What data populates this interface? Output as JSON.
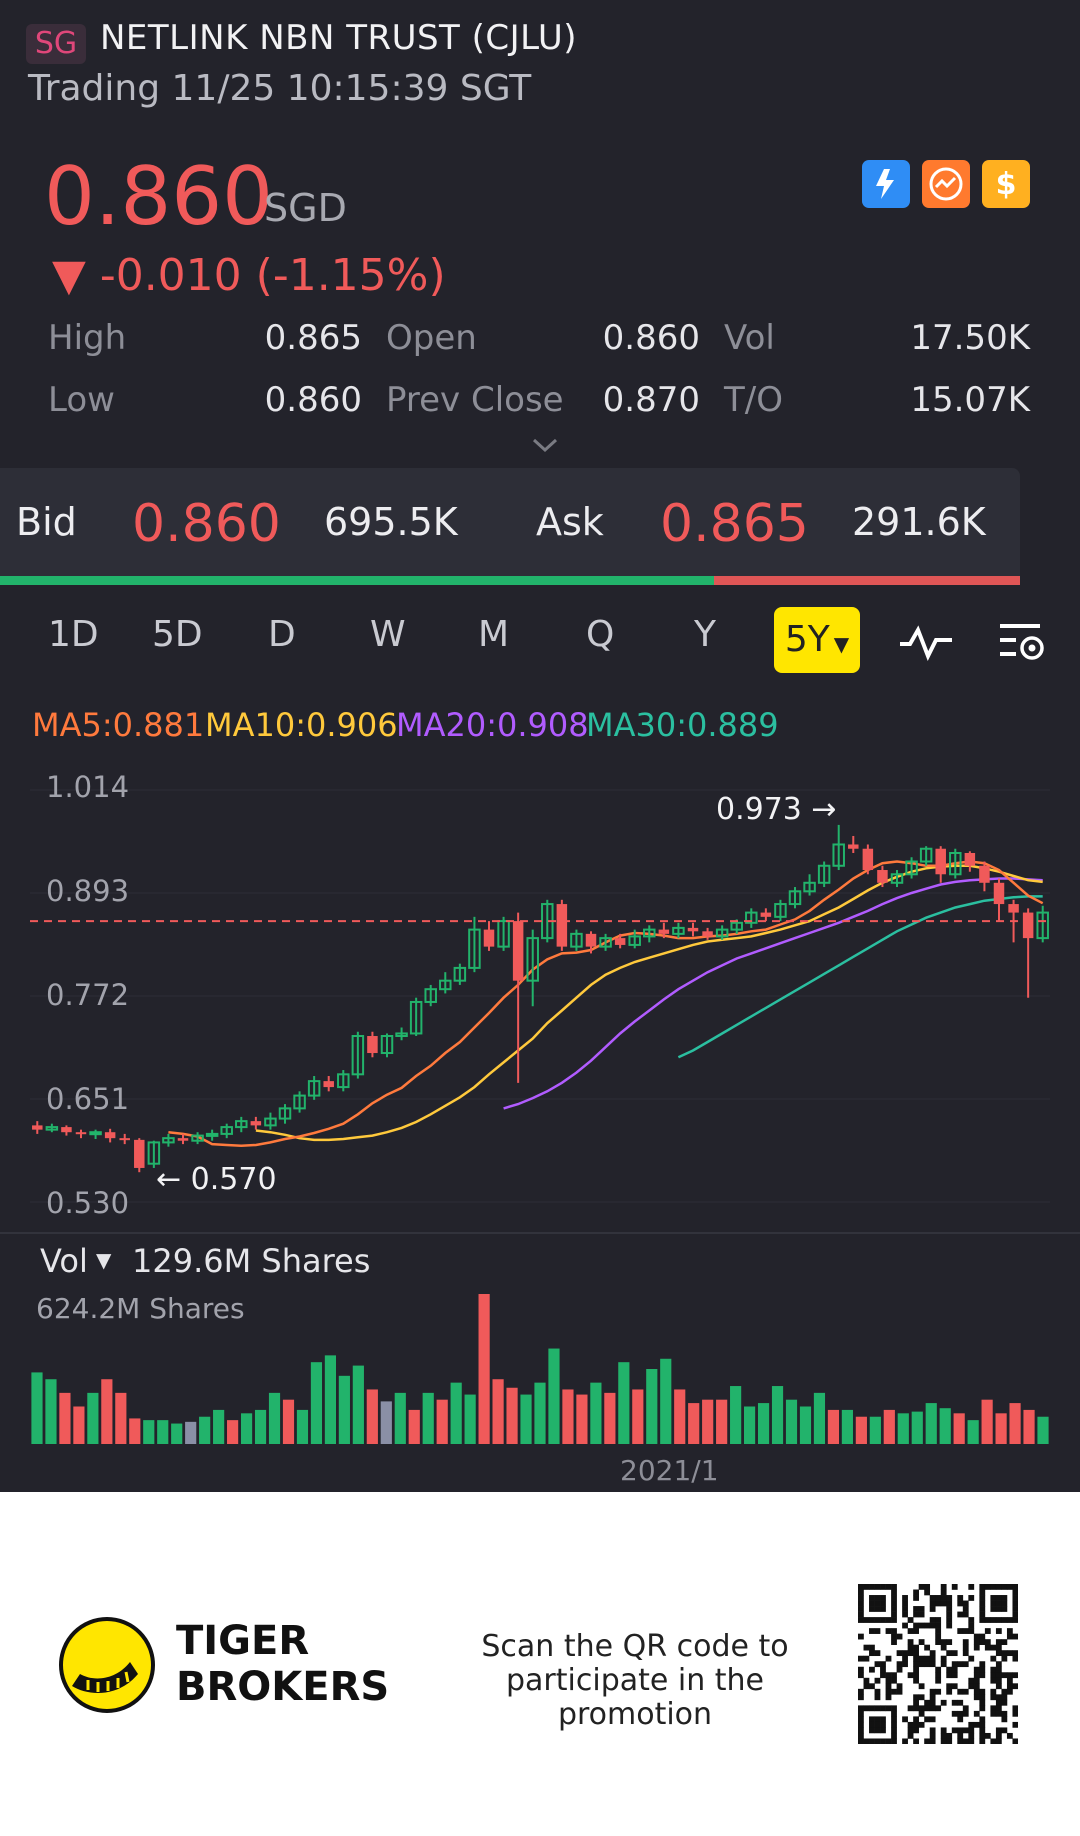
{
  "header": {
    "market_badge": "SG",
    "title": "NETLINK NBN TRUST (CJLU)",
    "status": "Trading 11/25 10:15:39 SGT"
  },
  "quote": {
    "price": "0.860",
    "currency": "SGD",
    "change": "▼ -0.010 (-1.15%)",
    "stats": {
      "high_label": "High",
      "high": "0.865",
      "open_label": "Open",
      "open": "0.860",
      "vol_label": "Vol",
      "vol": "17.50K",
      "low_label": "Low",
      "low": "0.860",
      "prev_close_label": "Prev Close",
      "prev_close": "0.870",
      "turnover_label": "T/O",
      "turnover": "15.07K"
    },
    "icons": [
      "lightning-level1-icon",
      "chart-badge-icon",
      "dollar-icon"
    ]
  },
  "orderbook": {
    "bid_label": "Bid",
    "bid": "0.860",
    "bid_qty": "695.5K",
    "ask_label": "Ask",
    "ask": "0.865",
    "ask_qty": "291.6K",
    "bid_share": 0.7
  },
  "tabs": [
    "1D",
    "5D",
    "D",
    "W",
    "M",
    "Q",
    "Y"
  ],
  "active_tab": "5Y",
  "moving_averages": {
    "ma5": "MA5:0.881",
    "ma10": "MA10:0.906",
    "ma20": "MA20:0.908",
    "ma30": "MA30:0.889"
  },
  "colors": {
    "up": "#22b36b",
    "down": "#f05a5a",
    "ma5": "#ff7a3d",
    "ma10": "#ffc93c",
    "ma20": "#b15cff",
    "ma30": "#2bbfa0",
    "accent": "#ffe600"
  },
  "chart_data": {
    "type": "candlestick",
    "y_ticks": [
      "1.014",
      "0.893",
      "0.772",
      "0.651",
      "0.530"
    ],
    "ylim": [
      0.53,
      1.014
    ],
    "max_annotation": "0.973 →",
    "min_annotation": "← 0.570",
    "last_price": 0.86,
    "candles": [
      [
        0.62,
        0.615,
        0.625,
        0.61
      ],
      [
        0.615,
        0.618,
        0.622,
        0.612
      ],
      [
        0.618,
        0.612,
        0.62,
        0.608
      ],
      [
        0.612,
        0.61,
        0.615,
        0.605
      ],
      [
        0.61,
        0.612,
        0.615,
        0.604
      ],
      [
        0.612,
        0.605,
        0.616,
        0.6
      ],
      [
        0.605,
        0.603,
        0.61,
        0.598
      ],
      [
        0.603,
        0.57,
        0.605,
        0.565
      ],
      [
        0.575,
        0.6,
        0.602,
        0.57
      ],
      [
        0.6,
        0.605,
        0.61,
        0.595
      ],
      [
        0.605,
        0.602,
        0.61,
        0.598
      ],
      [
        0.602,
        0.608,
        0.612,
        0.598
      ],
      [
        0.608,
        0.61,
        0.615,
        0.602
      ],
      [
        0.61,
        0.618,
        0.622,
        0.605
      ],
      [
        0.618,
        0.625,
        0.63,
        0.612
      ],
      [
        0.625,
        0.62,
        0.63,
        0.615
      ],
      [
        0.62,
        0.628,
        0.635,
        0.615
      ],
      [
        0.628,
        0.64,
        0.645,
        0.622
      ],
      [
        0.64,
        0.655,
        0.66,
        0.635
      ],
      [
        0.655,
        0.672,
        0.678,
        0.65
      ],
      [
        0.672,
        0.665,
        0.678,
        0.66
      ],
      [
        0.665,
        0.68,
        0.685,
        0.66
      ],
      [
        0.68,
        0.725,
        0.73,
        0.675
      ],
      [
        0.725,
        0.705,
        0.73,
        0.7
      ],
      [
        0.705,
        0.725,
        0.728,
        0.7
      ],
      [
        0.725,
        0.728,
        0.735,
        0.72
      ],
      [
        0.728,
        0.765,
        0.77,
        0.725
      ],
      [
        0.765,
        0.78,
        0.785,
        0.76
      ],
      [
        0.78,
        0.79,
        0.8,
        0.775
      ],
      [
        0.79,
        0.805,
        0.81,
        0.785
      ],
      [
        0.805,
        0.85,
        0.865,
        0.8
      ],
      [
        0.85,
        0.83,
        0.86,
        0.825
      ],
      [
        0.83,
        0.86,
        0.865,
        0.825
      ],
      [
        0.86,
        0.79,
        0.87,
        0.67
      ],
      [
        0.79,
        0.84,
        0.85,
        0.76
      ],
      [
        0.84,
        0.88,
        0.885,
        0.835
      ],
      [
        0.88,
        0.83,
        0.885,
        0.825
      ],
      [
        0.83,
        0.845,
        0.85,
        0.825
      ],
      [
        0.845,
        0.83,
        0.848,
        0.822
      ],
      [
        0.83,
        0.84,
        0.845,
        0.825
      ],
      [
        0.84,
        0.832,
        0.845,
        0.828
      ],
      [
        0.832,
        0.842,
        0.85,
        0.828
      ],
      [
        0.842,
        0.85,
        0.855,
        0.835
      ],
      [
        0.85,
        0.845,
        0.858,
        0.84
      ],
      [
        0.845,
        0.852,
        0.858,
        0.84
      ],
      [
        0.852,
        0.848,
        0.858,
        0.842
      ],
      [
        0.848,
        0.842,
        0.852,
        0.838
      ],
      [
        0.842,
        0.85,
        0.855,
        0.838
      ],
      [
        0.85,
        0.858,
        0.862,
        0.845
      ],
      [
        0.858,
        0.87,
        0.875,
        0.852
      ],
      [
        0.87,
        0.865,
        0.875,
        0.86
      ],
      [
        0.865,
        0.88,
        0.885,
        0.86
      ],
      [
        0.88,
        0.895,
        0.9,
        0.875
      ],
      [
        0.895,
        0.905,
        0.915,
        0.89
      ],
      [
        0.905,
        0.925,
        0.93,
        0.9
      ],
      [
        0.925,
        0.95,
        0.973,
        0.92
      ],
      [
        0.95,
        0.945,
        0.96,
        0.94
      ],
      [
        0.945,
        0.92,
        0.95,
        0.915
      ],
      [
        0.92,
        0.905,
        0.925,
        0.9
      ],
      [
        0.905,
        0.915,
        0.92,
        0.9
      ],
      [
        0.915,
        0.93,
        0.935,
        0.91
      ],
      [
        0.93,
        0.945,
        0.948,
        0.925
      ],
      [
        0.945,
        0.915,
        0.948,
        0.905
      ],
      [
        0.915,
        0.94,
        0.945,
        0.91
      ],
      [
        0.94,
        0.925,
        0.942,
        0.918
      ],
      [
        0.925,
        0.905,
        0.93,
        0.895
      ],
      [
        0.905,
        0.88,
        0.91,
        0.86
      ],
      [
        0.88,
        0.87,
        0.885,
        0.835
      ],
      [
        0.87,
        0.84,
        0.875,
        0.77
      ],
      [
        0.84,
        0.87,
        0.878,
        0.835
      ]
    ],
    "ma_series": {
      "ma5": [
        0.612,
        0.61,
        0.607,
        0.598,
        0.597,
        0.596,
        0.597,
        0.6,
        0.604,
        0.607,
        0.611,
        0.616,
        0.622,
        0.633,
        0.646,
        0.656,
        0.664,
        0.678,
        0.69,
        0.705,
        0.718,
        0.735,
        0.752,
        0.77,
        0.785,
        0.803,
        0.815,
        0.822,
        0.823,
        0.826,
        0.835,
        0.843,
        0.846,
        0.845,
        0.843,
        0.84,
        0.84,
        0.842,
        0.843,
        0.845,
        0.848,
        0.85,
        0.856,
        0.862,
        0.872,
        0.885,
        0.897,
        0.91,
        0.92,
        0.928,
        0.93,
        0.928,
        0.925,
        0.925,
        0.928,
        0.93,
        0.928,
        0.92,
        0.905,
        0.89,
        0.881
      ],
      "ma10": [
        0.614,
        0.612,
        0.609,
        0.605,
        0.603,
        0.603,
        0.604,
        0.606,
        0.608,
        0.612,
        0.617,
        0.624,
        0.633,
        0.643,
        0.653,
        0.665,
        0.68,
        0.694,
        0.708,
        0.722,
        0.74,
        0.755,
        0.77,
        0.785,
        0.797,
        0.805,
        0.812,
        0.817,
        0.822,
        0.827,
        0.832,
        0.836,
        0.838,
        0.84,
        0.842,
        0.846,
        0.85,
        0.855,
        0.86,
        0.868,
        0.876,
        0.886,
        0.896,
        0.905,
        0.912,
        0.918,
        0.922,
        0.924,
        0.925,
        0.925,
        0.922,
        0.918,
        0.913,
        0.908,
        0.906
      ],
      "ma20": [
        0.64,
        0.645,
        0.652,
        0.66,
        0.67,
        0.682,
        0.696,
        0.712,
        0.728,
        0.742,
        0.755,
        0.768,
        0.78,
        0.79,
        0.8,
        0.808,
        0.816,
        0.822,
        0.828,
        0.834,
        0.84,
        0.846,
        0.852,
        0.858,
        0.865,
        0.872,
        0.88,
        0.887,
        0.893,
        0.898,
        0.903,
        0.906,
        0.908,
        0.909,
        0.91,
        0.91,
        0.909,
        0.908
      ],
      "ma30": [
        0.7,
        0.708,
        0.718,
        0.728,
        0.738,
        0.748,
        0.758,
        0.768,
        0.778,
        0.788,
        0.798,
        0.808,
        0.818,
        0.828,
        0.838,
        0.848,
        0.856,
        0.864,
        0.87,
        0.876,
        0.88,
        0.884,
        0.886,
        0.888,
        0.889,
        0.889
      ]
    },
    "volume_label": "Vol",
    "volume_value": "129.6M Shares",
    "volume_max_label": "624.2M Shares",
    "x_tick": "2021/1",
    "volumes": [
      [
        210,
        "up"
      ],
      [
        190,
        "up"
      ],
      [
        150,
        "down"
      ],
      [
        110,
        "down"
      ],
      [
        150,
        "up"
      ],
      [
        190,
        "down"
      ],
      [
        150,
        "down"
      ],
      [
        75,
        "down"
      ],
      [
        70,
        "up"
      ],
      [
        70,
        "up"
      ],
      [
        60,
        "up"
      ],
      [
        65,
        "gray"
      ],
      [
        80,
        "up"
      ],
      [
        100,
        "up"
      ],
      [
        70,
        "down"
      ],
      [
        90,
        "up"
      ],
      [
        100,
        "up"
      ],
      [
        150,
        "up"
      ],
      [
        130,
        "down"
      ],
      [
        100,
        "up"
      ],
      [
        240,
        "up"
      ],
      [
        260,
        "up"
      ],
      [
        200,
        "up"
      ],
      [
        230,
        "up"
      ],
      [
        160,
        "down"
      ],
      [
        125,
        "gray"
      ],
      [
        150,
        "up"
      ],
      [
        100,
        "down"
      ],
      [
        150,
        "up"
      ],
      [
        130,
        "down"
      ],
      [
        180,
        "up"
      ],
      [
        145,
        "up"
      ],
      [
        440,
        "down"
      ],
      [
        190,
        "down"
      ],
      [
        165,
        "down"
      ],
      [
        145,
        "up"
      ],
      [
        180,
        "up"
      ],
      [
        280,
        "up"
      ],
      [
        160,
        "down"
      ],
      [
        145,
        "down"
      ],
      [
        180,
        "up"
      ],
      [
        150,
        "down"
      ],
      [
        240,
        "up"
      ],
      [
        160,
        "down"
      ],
      [
        220,
        "up"
      ],
      [
        250,
        "up"
      ],
      [
        160,
        "down"
      ],
      [
        120,
        "down"
      ],
      [
        130,
        "down"
      ],
      [
        130,
        "down"
      ],
      [
        170,
        "up"
      ],
      [
        110,
        "up"
      ],
      [
        120,
        "up"
      ],
      [
        170,
        "up"
      ],
      [
        130,
        "up"
      ],
      [
        110,
        "up"
      ],
      [
        150,
        "up"
      ],
      [
        100,
        "down"
      ],
      [
        100,
        "up"
      ],
      [
        80,
        "down"
      ],
      [
        80,
        "up"
      ],
      [
        100,
        "down"
      ],
      [
        90,
        "up"
      ],
      [
        95,
        "up"
      ],
      [
        120,
        "up"
      ],
      [
        105,
        "up"
      ],
      [
        90,
        "down"
      ],
      [
        70,
        "up"
      ],
      [
        130,
        "down"
      ],
      [
        90,
        "down"
      ],
      [
        120,
        "down"
      ],
      [
        100,
        "down"
      ],
      [
        80,
        "up"
      ]
    ]
  },
  "footer": {
    "brand_line1": "TIGER",
    "brand_line2": "BROKERS",
    "promo_line1": "Scan the QR code to",
    "promo_line2": "participate in the promotion"
  }
}
